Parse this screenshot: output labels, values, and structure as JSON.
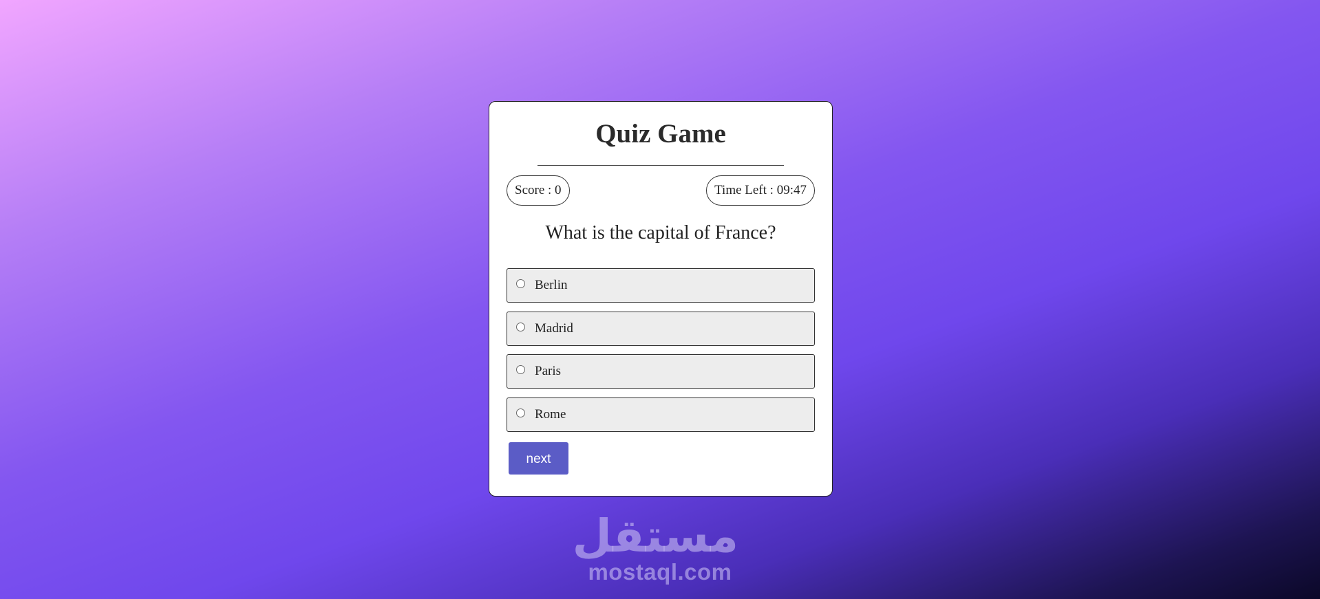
{
  "quiz": {
    "title": "Quiz Game",
    "score_text": "Score : 0",
    "timer_text": "Time Left : 09:47",
    "question": "What is the capital of France?",
    "options": [
      "Berlin",
      "Madrid",
      "Paris",
      "Rome"
    ],
    "next_label": "next"
  },
  "watermark": {
    "arabic": "مستقل",
    "latin": "mostaql.com"
  },
  "colors": {
    "accent_button": "#5b5cc6",
    "option_background": "#ededed",
    "gradient_start": "#f1a6ff",
    "gradient_mid": "#6f47ec",
    "gradient_end": "#0b0828"
  }
}
